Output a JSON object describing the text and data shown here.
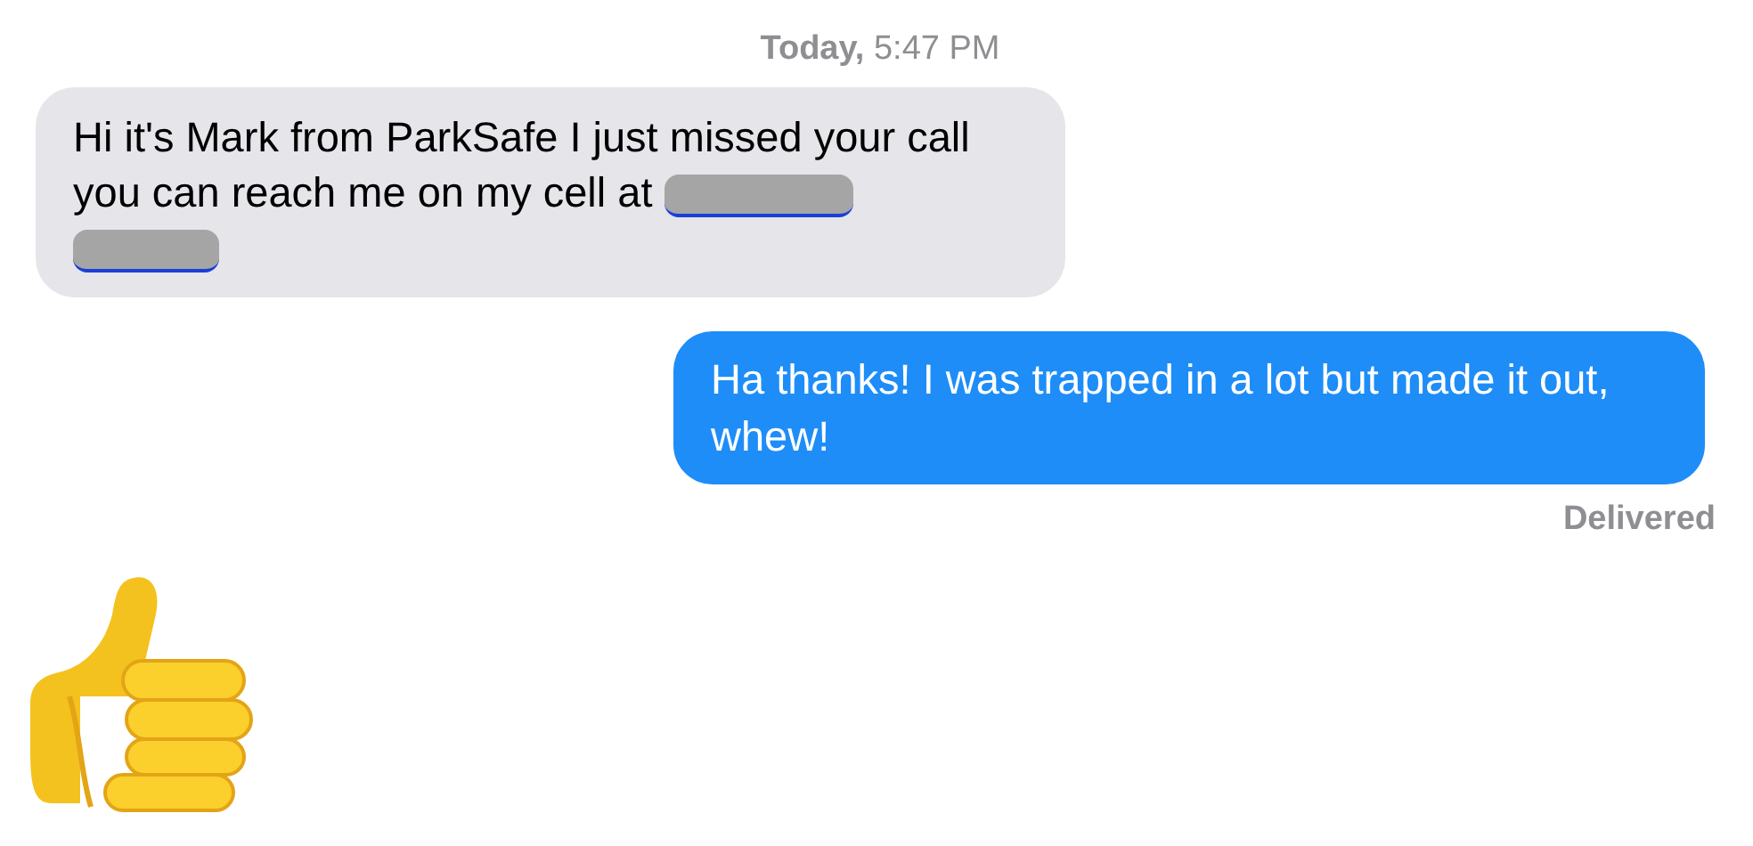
{
  "timestamp": {
    "day": "Today,",
    "time": "5:47 PM"
  },
  "messages": [
    {
      "kind": "incoming",
      "text": "Hi it's Mark from ParkSafe I just missed your call you can reach me on my cell at",
      "redacted_link": true
    },
    {
      "kind": "outgoing",
      "text": "Ha thanks! I was trapped in a lot but made it out, whew!",
      "status": "Delivered"
    },
    {
      "kind": "emoji"
    }
  ]
}
